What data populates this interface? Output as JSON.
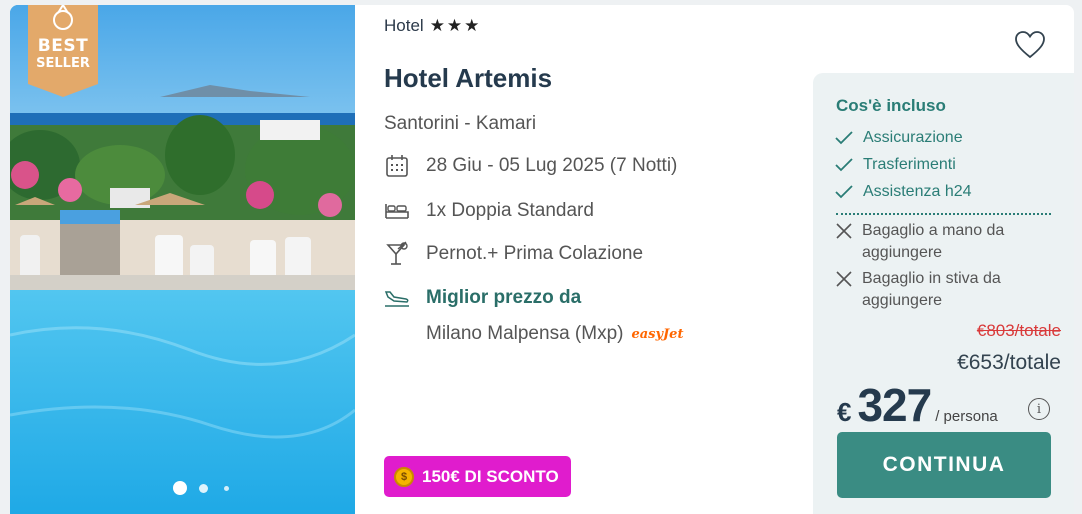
{
  "badge": {
    "line1": "BEST",
    "line2": "SELLER"
  },
  "gallery": {
    "dots": 3,
    "active_dot": 1
  },
  "hotel": {
    "category": "Hotel",
    "stars_text": "★★★",
    "stars": 3,
    "name": "Hotel Artemis",
    "location": "Santorini - Kamari"
  },
  "details": {
    "dates": "28 Giu - 05 Lug 2025 (7 Notti)",
    "room": "1x Doppia Standard",
    "board": "Pernot.+ Prima Colazione",
    "flight_label": "Miglior prezzo da",
    "airport": "Milano Malpensa (Mxp)",
    "airline": "easyJet"
  },
  "discount": {
    "label": "150€ DI SCONTO",
    "color": "#e01ccd"
  },
  "included": {
    "title": "Cos'è incluso",
    "items": [
      "Assicurazione",
      "Trasferimenti",
      "Assistenza h24"
    ],
    "excluded": [
      "Bagaglio a mano da aggiungere",
      "Bagaglio in stiva da aggiungere"
    ]
  },
  "pricing": {
    "old_total": "€803/totale",
    "total": "€653/totale",
    "currency": "€",
    "per_person_value": "327",
    "per_person_label": "/ persona",
    "info_symbol": "i"
  },
  "cta": {
    "label": "CONTINUA",
    "color": "#3a8c83"
  },
  "icons": {
    "favorite": "heart-outline-icon",
    "dates": "calendar-icon",
    "room": "bed-icon",
    "board": "cocktail-icon",
    "flight": "plane-landing-icon",
    "included": "check-icon",
    "excluded": "close-icon"
  }
}
